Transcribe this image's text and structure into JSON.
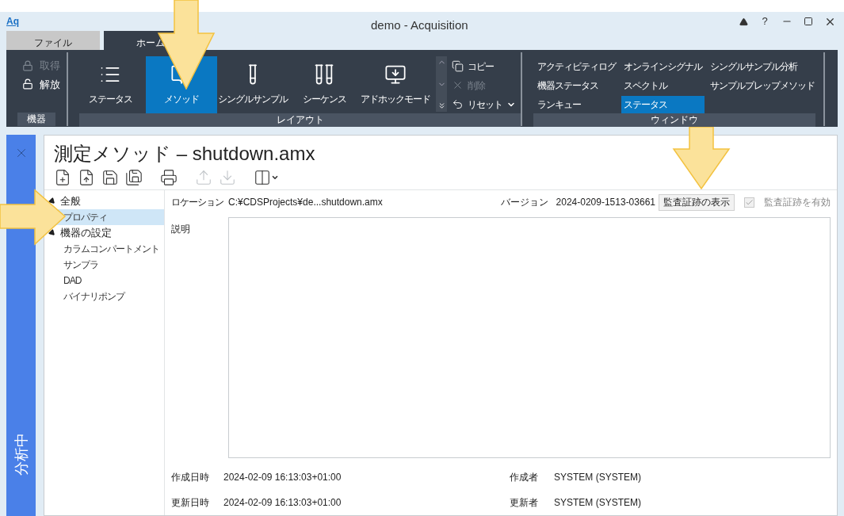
{
  "window": {
    "logo": "Aq",
    "title": "demo - Acquisition",
    "help": "?"
  },
  "tabs": [
    {
      "label": "ファイル",
      "selected": false
    },
    {
      "label": "ホーム",
      "selected": true
    }
  ],
  "ribbon": {
    "groups": [
      {
        "kind": "lock",
        "label": "機器",
        "items": [
          {
            "label": "取得",
            "disabled": true
          },
          {
            "label": "解放",
            "disabled": false
          }
        ]
      },
      {
        "kind": "layout",
        "label": "レイアウト",
        "items": [
          {
            "label": "ステータス",
            "selected": false
          },
          {
            "label": "メソッド",
            "selected": true
          },
          {
            "label": "シングルサンプル",
            "selected": false
          },
          {
            "label": "シーケンス",
            "selected": false
          },
          {
            "label": "アドホックモード",
            "selected": false
          }
        ],
        "actions": [
          {
            "label": "コピー",
            "disabled": false,
            "dropdown": false
          },
          {
            "label": "削除",
            "disabled": true,
            "dropdown": false
          },
          {
            "label": "リセット",
            "disabled": false,
            "dropdown": true
          }
        ]
      },
      {
        "kind": "window",
        "label": "ウィンドウ",
        "columns": [
          [
            {
              "label": "アクティビティログ",
              "selected": false
            },
            {
              "label": "機器ステータス",
              "selected": false
            },
            {
              "label": "ランキュー",
              "selected": false
            }
          ],
          [
            {
              "label": "オンラインシグナル",
              "selected": false
            },
            {
              "label": "スペクトル",
              "selected": false
            },
            {
              "label": "ステータス",
              "selected": true
            }
          ],
          [
            {
              "label": "シングルサンプル分析",
              "selected": false
            },
            {
              "label": "サンプルプレップメソッド",
              "selected": false
            }
          ]
        ]
      }
    ]
  },
  "side_panel": {
    "status": "分析中"
  },
  "document": {
    "title": "測定メソッド – shutdown.amx",
    "toolbar": [
      {
        "disabled": false
      },
      {
        "disabled": false
      },
      {
        "disabled": false
      },
      {
        "disabled": false
      },
      {
        "disabled": false
      },
      {
        "disabled": true
      },
      {
        "disabled": true
      },
      {
        "disabled": false
      }
    ],
    "tree": [
      {
        "label": "全般",
        "expanded": true,
        "children": [
          {
            "label": "プロパティ",
            "selected": true
          }
        ]
      },
      {
        "label": "機器の設定",
        "expanded": true,
        "children": [
          {
            "label": "カラムコンパートメント",
            "selected": false
          },
          {
            "label": "サンプラ",
            "selected": false
          },
          {
            "label": "DAD",
            "selected": false
          },
          {
            "label": "バイナリポンプ",
            "selected": false
          }
        ]
      }
    ],
    "properties": {
      "location_label": "ロケーション",
      "location": "C:¥CDSProjects¥de...shutdown.amx",
      "version_label": "バージョン",
      "version": "2024-0209-1513-03661",
      "audit_button": "監査証跡の表示",
      "audit_checkbox": {
        "label": "監査証跡を有効",
        "checked": true,
        "disabled": true
      },
      "description_label": "説明",
      "footer": [
        {
          "label": "作成日時",
          "value": "2024-02-09 16:13:03+01:00",
          "by_label": "作成者",
          "by": "SYSTEM (SYSTEM)"
        },
        {
          "label": "更新日時",
          "value": "2024-02-09 16:13:03+01:00",
          "by_label": "更新者",
          "by": "SYSTEM (SYSTEM)"
        }
      ]
    }
  },
  "annotations": [
    {
      "kind": "arrow"
    },
    {
      "kind": "arrow"
    },
    {
      "kind": "arrow"
    }
  ]
}
